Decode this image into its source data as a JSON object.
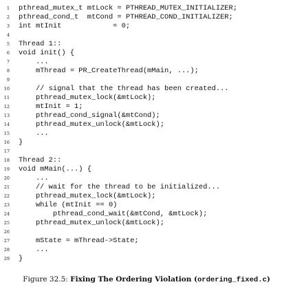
{
  "listing": {
    "lines": [
      {
        "number": "1",
        "text": "pthread_mutex_t mtLock = PTHREAD_MUTEX_INITIALIZER;"
      },
      {
        "number": "2",
        "text": "pthread_cond_t  mtCond = PTHREAD_COND_INITIALIZER;"
      },
      {
        "number": "3",
        "text": "int mtInit            = 0;"
      },
      {
        "number": "4",
        "text": ""
      },
      {
        "number": "5",
        "text": "Thread 1::"
      },
      {
        "number": "6",
        "text": "void init() {"
      },
      {
        "number": "7",
        "text": "    ..."
      },
      {
        "number": "8",
        "text": "    mThread = PR_CreateThread(mMain, ...);"
      },
      {
        "number": "9",
        "text": ""
      },
      {
        "number": "10",
        "text": "    // signal that the thread has been created..."
      },
      {
        "number": "11",
        "text": "    pthread_mutex_lock(&mtLock);"
      },
      {
        "number": "12",
        "text": "    mtInit = 1;"
      },
      {
        "number": "13",
        "text": "    pthread_cond_signal(&mtCond);"
      },
      {
        "number": "14",
        "text": "    pthread_mutex_unlock(&mtLock);"
      },
      {
        "number": "15",
        "text": "    ..."
      },
      {
        "number": "16",
        "text": "}"
      },
      {
        "number": "17",
        "text": ""
      },
      {
        "number": "18",
        "text": "Thread 2::"
      },
      {
        "number": "19",
        "text": "void mMain(...) {"
      },
      {
        "number": "20",
        "text": "    ..."
      },
      {
        "number": "21",
        "text": "    // wait for the thread to be initialized..."
      },
      {
        "number": "22",
        "text": "    pthread_mutex_lock(&mtLock);"
      },
      {
        "number": "23",
        "text": "    while (mtInit == 0)"
      },
      {
        "number": "24",
        "text": "        pthread_cond_wait(&mtCond, &mtLock);"
      },
      {
        "number": "25",
        "text": "    pthread_mutex_unlock(&mtLock);"
      },
      {
        "number": "26",
        "text": ""
      },
      {
        "number": "27",
        "text": "    mState = mThread->State;"
      },
      {
        "number": "28",
        "text": "    ..."
      },
      {
        "number": "29",
        "text": "}"
      }
    ]
  },
  "caption": {
    "label": "Figure 32.5: ",
    "title": "Fixing The Ordering Violation (",
    "filename": "ordering_fixed.c",
    "close": ")"
  }
}
